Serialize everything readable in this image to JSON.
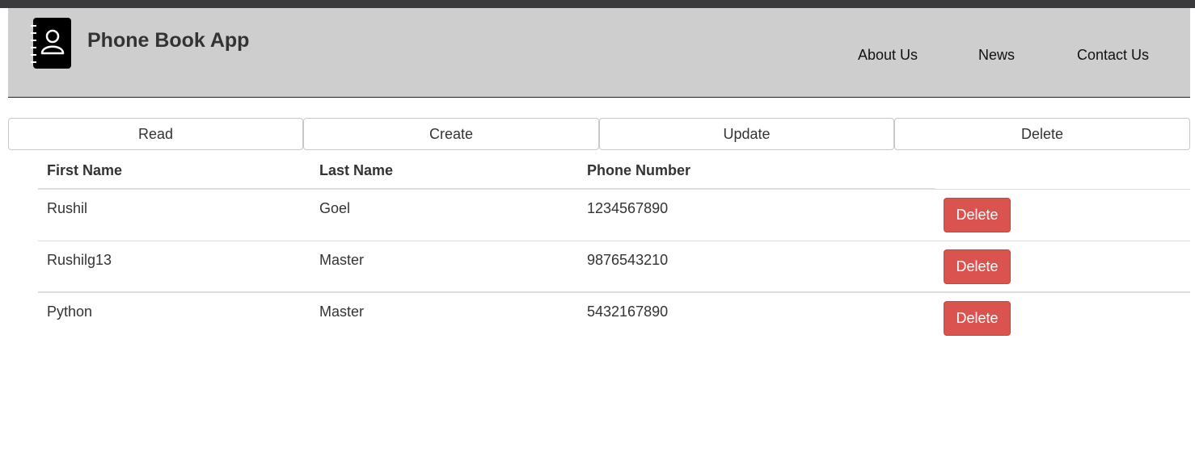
{
  "app": {
    "title": "Phone Book App",
    "logo_icon": "address-book-icon"
  },
  "nav": {
    "items": [
      {
        "label": "About Us"
      },
      {
        "label": "News"
      },
      {
        "label": "Contact Us"
      }
    ]
  },
  "tabs": [
    {
      "label": "Read"
    },
    {
      "label": "Create"
    },
    {
      "label": "Update"
    },
    {
      "label": "Delete"
    }
  ],
  "table": {
    "headers": {
      "first_name": "First Name",
      "last_name": "Last Name",
      "phone": "Phone Number"
    },
    "rows": [
      {
        "first_name": "Rushil",
        "last_name": "Goel",
        "phone": "1234567890",
        "action": "Delete"
      },
      {
        "first_name": "Rushilg13",
        "last_name": "Master",
        "phone": "9876543210",
        "action": "Delete"
      },
      {
        "first_name": "Python",
        "last_name": "Master",
        "phone": "5432167890",
        "action": "Delete"
      }
    ]
  },
  "colors": {
    "header_bg": "#cecece",
    "delete_button": "#d9534f"
  }
}
